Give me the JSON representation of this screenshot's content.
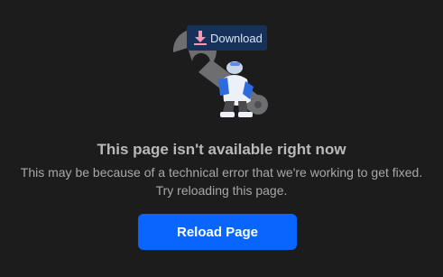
{
  "error": {
    "title": "This page isn't available right now",
    "message": "This may be because of a technical error that we're working to get fixed. Try reloading this page."
  },
  "actions": {
    "reload_label": "Reload Page",
    "download_label": "Download",
    "download_icon": "download-arrow-icon"
  },
  "illustration": {
    "name": "wrench-robot-illustration"
  },
  "colors": {
    "background": "#1c1c1d",
    "primary_button": "#0866ff",
    "download_bg": "#17325a",
    "download_icon": "#f09ab5",
    "title_text": "#b9b9ba",
    "body_text": "#a8a8a9"
  }
}
